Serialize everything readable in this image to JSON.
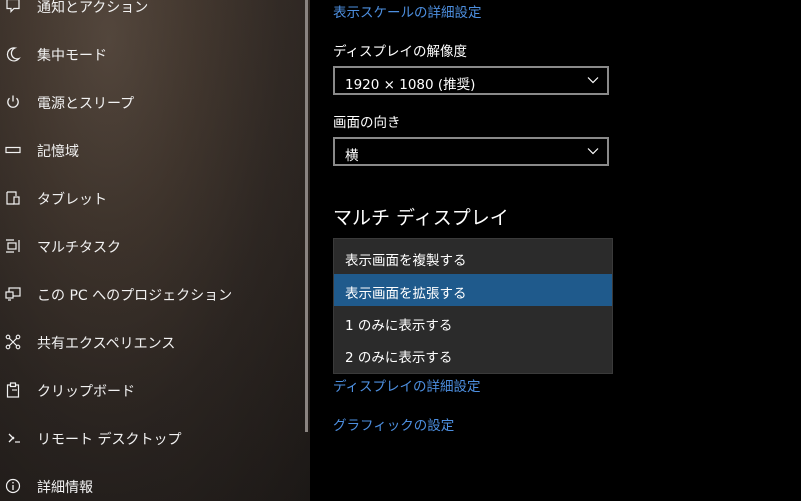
{
  "sidebar": {
    "items": [
      {
        "label": "通知とアクション",
        "icon": "notification-icon"
      },
      {
        "label": "集中モード",
        "icon": "moon-icon"
      },
      {
        "label": "電源とスリープ",
        "icon": "power-icon"
      },
      {
        "label": "記憶域",
        "icon": "storage-icon"
      },
      {
        "label": "タブレット",
        "icon": "tablet-icon"
      },
      {
        "label": "マルチタスク",
        "icon": "multitask-icon"
      },
      {
        "label": "この PC へのプロジェクション",
        "icon": "projection-icon"
      },
      {
        "label": "共有エクスペリエンス",
        "icon": "shared-experiences-icon"
      },
      {
        "label": "クリップボード",
        "icon": "clipboard-icon"
      },
      {
        "label": "リモート デスクトップ",
        "icon": "remote-desktop-icon"
      },
      {
        "label": "詳細情報",
        "icon": "info-icon"
      }
    ]
  },
  "main": {
    "scale_link": "表示スケールの詳細設定",
    "resolution_label": "ディスプレイの解像度",
    "resolution_value": "1920 × 1080 (推奨)",
    "orientation_label": "画面の向き",
    "orientation_value": "横",
    "multi_display_heading": "マルチ ディスプレイ",
    "multi_display_options": [
      "表示画面を複製する",
      "表示画面を拡張する",
      "1 のみに表示する",
      "2 のみに表示する"
    ],
    "multi_display_selected": "表示画面を拡張する",
    "advanced_display_link": "ディスプレイの詳細設定",
    "graphics_link": "グラフィックの設定"
  },
  "colors": {
    "accent": "#1f5a8c",
    "link": "#4d8fe0"
  }
}
